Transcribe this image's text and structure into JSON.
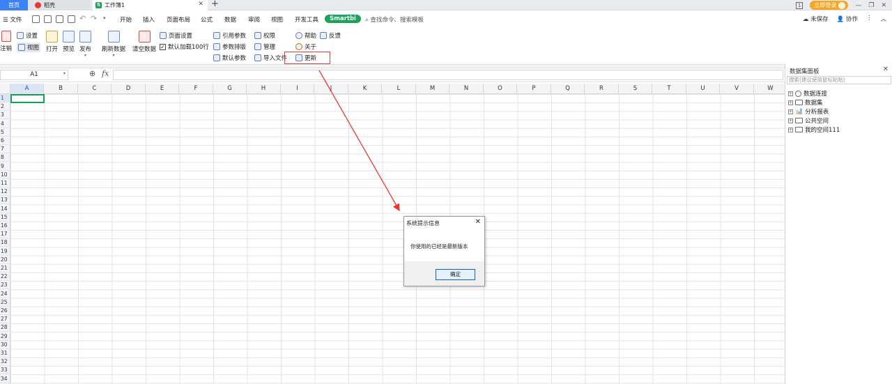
{
  "tabs": {
    "home": "首页",
    "daoke": "稻壳",
    "book": "工作簿1",
    "close_glyph": "✕",
    "add_glyph": "+"
  },
  "topbar": {
    "badge": "1",
    "login": "立即登录",
    "minimize": "—",
    "restore": "❐",
    "close": "✕"
  },
  "menubar": {
    "file": "☰ 文件",
    "items": [
      "开始",
      "插入",
      "页面布局",
      "公式",
      "数据",
      "审阅",
      "视图",
      "开发工具"
    ],
    "smartbi": "Smartbi",
    "search": "查找命令、搜索模板",
    "unsaved": "未保存",
    "collab": "协作",
    "more": "⋮",
    "collapse": "︿"
  },
  "ribbon": {
    "logout": "注销",
    "settings": "设置",
    "view": "视图",
    "open": "打开",
    "preview": "预览",
    "publish": "发布",
    "refresh": "刷新数据",
    "clear": "清空数据",
    "page_setup": "页面设置",
    "default_load": "默认加载100行",
    "ref_param": "引用参数",
    "param_layout": "参数排版",
    "default_param": "默认参数",
    "permission": "权限",
    "manage": "管理",
    "import_file": "导入文件",
    "help": "帮助",
    "feedback": "反馈",
    "about": "关于",
    "update": "更新"
  },
  "formula": {
    "cell_ref": "A1"
  },
  "grid": {
    "columns": [
      "A",
      "B",
      "C",
      "D",
      "E",
      "F",
      "G",
      "H",
      "I",
      "J",
      "K",
      "L",
      "M",
      "N",
      "O",
      "P",
      "Q",
      "R",
      "S",
      "T",
      "U",
      "V",
      "W"
    ],
    "rows": [
      "1",
      "2",
      "3",
      "4",
      "5",
      "6",
      "7",
      "8",
      "9",
      "10",
      "11",
      "12",
      "13",
      "14",
      "15",
      "16",
      "17",
      "18",
      "19",
      "20",
      "21",
      "22",
      "23",
      "24",
      "25",
      "26",
      "27",
      "28",
      "29",
      "30",
      "31",
      "32",
      "33",
      "34"
    ]
  },
  "panel": {
    "title": "数据集面板",
    "search_placeholder": "搜索(建议使用鼠标粘贴)",
    "items": [
      "数据连接",
      "数据集",
      "分析报表",
      "公共空间",
      "我的空间111"
    ]
  },
  "dialog": {
    "title": "系统提示信息",
    "message": "你使用的已经是最新版本",
    "ok": "确定"
  },
  "colors": {
    "accent_blue": "#3b82f6",
    "smartbi_green": "#1aa35a",
    "highlight_red": "#e53935",
    "login_orange": "#f5a623"
  }
}
